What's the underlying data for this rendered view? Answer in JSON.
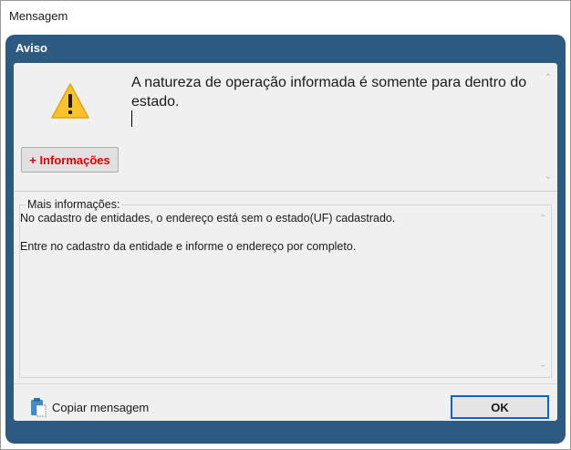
{
  "window": {
    "title": "Mensagem"
  },
  "dialog": {
    "header": "Aviso",
    "icon": "warning-icon",
    "message": "A natureza de operação informada é somente para dentro do estado.",
    "info_button_label": "+ Informações",
    "details": {
      "legend": "Mais informações:",
      "lines": [
        "No cadastro de entidades, o endereço está sem o estado(UF) cadastrado.",
        "Entre no cadastro da entidade e informe o endereço por completo."
      ]
    },
    "copy_button_label": "Copiar mensagem",
    "copy_icon": "clipboard-icon",
    "ok_button_label": "OK"
  },
  "colors": {
    "dialog_frame": "#2d5a80",
    "info_button_text": "#e00000",
    "ok_button_border": "#0f63c4",
    "warning_fill": "#fbc22b"
  }
}
